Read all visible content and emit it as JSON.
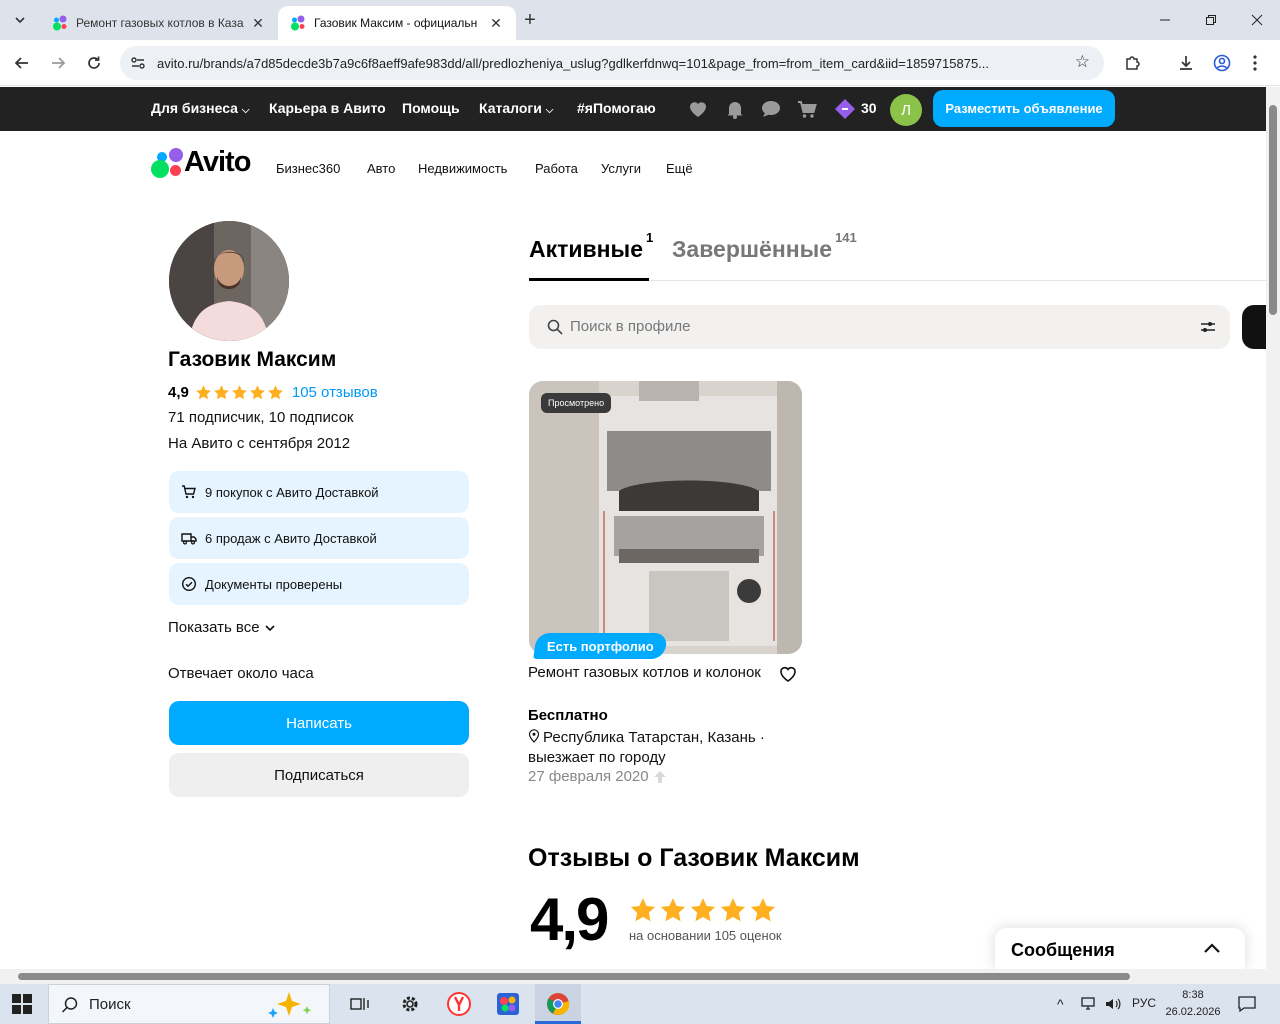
{
  "browser": {
    "tabs": [
      {
        "title": "Ремонт газовых котлов в Каза",
        "active": false
      },
      {
        "title": "Газовик Максим - официальн",
        "active": true
      }
    ],
    "url": "avito.ru/brands/a7d85decde3b7a9c6f8aeff9afe983dd/all/predlozheniya_uslug?gdlkerfdnwq=101&page_from=from_item_card&iid=1859715875..."
  },
  "topbar": {
    "links": [
      "Для бизнеса",
      "Карьера в Авито",
      "Помощь",
      "Каталоги",
      "#яПомогаю"
    ],
    "bonus_count": "30",
    "user_initial": "Л",
    "post_button": "Разместить объявление"
  },
  "header": {
    "logo_text": "Avito",
    "categories": [
      "Бизнес360",
      "Авто",
      "Недвижимость",
      "Работа",
      "Услуги",
      "Ещё"
    ]
  },
  "profile": {
    "name": "Газовик Максим",
    "rating": "4,9",
    "reviews_link": "105 отзывов",
    "subscribers": "71 подписчик, 10 подписок",
    "since": "На Авито с сентября 2012",
    "badges": [
      "9 покупок с Авито Доставкой",
      "6 продаж с Авито Доставкой",
      "Документы проверены"
    ],
    "show_all": "Показать все",
    "response_time": "Отвечает около часа",
    "write_button": "Написать",
    "subscribe_button": "Подписаться"
  },
  "listings_tabs": [
    {
      "label": "Активные",
      "count": "1"
    },
    {
      "label": "Завершённые",
      "count": "141"
    }
  ],
  "search": {
    "placeholder": "Поиск в профиле"
  },
  "card": {
    "seen_badge": "Просмотрено",
    "portfolio_badge": "Есть портфолио",
    "title": "Ремонт газовых котлов и колонок",
    "price": "Бесплатно",
    "location": "Республика Татарстан, Казань · выезжает по городу",
    "date": "27 февраля 2020"
  },
  "reviews": {
    "title": "Отзывы о Газовик Максим",
    "rating": "4,9",
    "based_on": "на основании 105 оценок"
  },
  "messages_widget": {
    "title": "Сообщения"
  },
  "taskbar": {
    "search_placeholder": "Поиск",
    "lang": "РУС",
    "time": "8:38",
    "date": "26.02.2026"
  },
  "colors": {
    "accent": "#00aaff",
    "topbar": "#222222",
    "star": "#ffb021",
    "badge_bg": "#e5f4ff"
  }
}
